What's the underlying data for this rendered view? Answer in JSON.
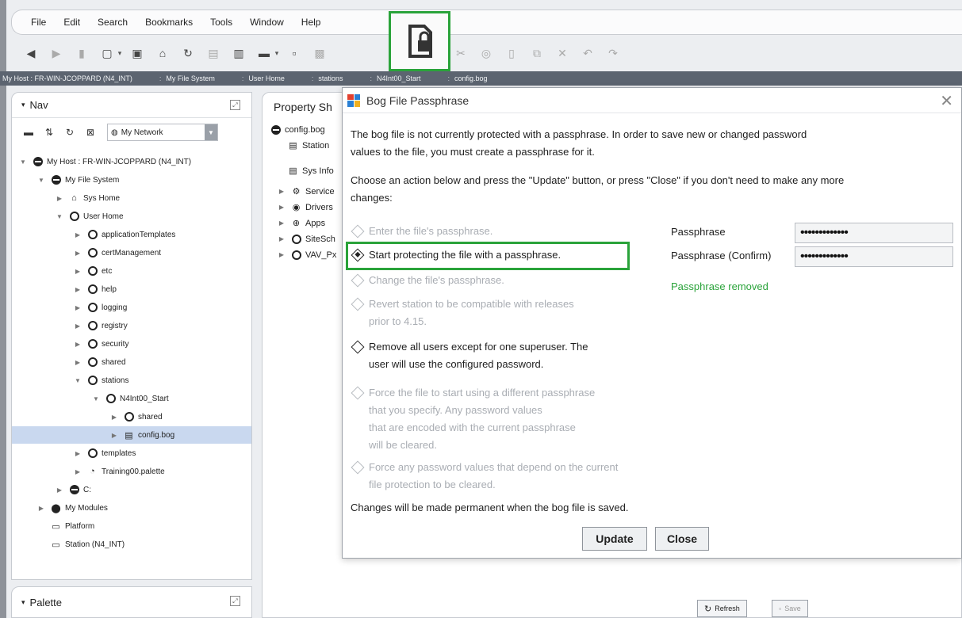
{
  "menubar": [
    "File",
    "Edit",
    "Search",
    "Bookmarks",
    "Tools",
    "Window",
    "Help"
  ],
  "breadcrumbs": [
    "My Host : FR-WIN-JCOPPARD (N4_INT)",
    "My File System",
    "User Home",
    "stations",
    "N4Int00_Start",
    "config.bog"
  ],
  "nav": {
    "title": "Nav",
    "network_select": "My Network",
    "tree": [
      {
        "label": "My Host : FR-WIN-JCOPPARD (N4_INT)",
        "depth": 0,
        "twisty": "open",
        "icon": "host-icon"
      },
      {
        "label": "My File System",
        "depth": 1,
        "twisty": "open",
        "icon": "disk-icon"
      },
      {
        "label": "Sys Home",
        "depth": 2,
        "twisty": "closed",
        "icon": "home-icon"
      },
      {
        "label": "User Home",
        "depth": 2,
        "twisty": "open",
        "icon": "folder-icon"
      },
      {
        "label": "applicationTemplates",
        "depth": 3,
        "twisty": "closed",
        "icon": "folder-icon"
      },
      {
        "label": "certManagement",
        "depth": 3,
        "twisty": "closed",
        "icon": "folder-icon"
      },
      {
        "label": "etc",
        "depth": 3,
        "twisty": "closed",
        "icon": "folder-icon"
      },
      {
        "label": "help",
        "depth": 3,
        "twisty": "closed",
        "icon": "folder-icon"
      },
      {
        "label": "logging",
        "depth": 3,
        "twisty": "closed",
        "icon": "folder-icon"
      },
      {
        "label": "registry",
        "depth": 3,
        "twisty": "closed",
        "icon": "folder-icon"
      },
      {
        "label": "security",
        "depth": 3,
        "twisty": "closed",
        "icon": "folder-icon"
      },
      {
        "label": "shared",
        "depth": 3,
        "twisty": "closed",
        "icon": "folder-icon"
      },
      {
        "label": "stations",
        "depth": 3,
        "twisty": "open",
        "icon": "folder-icon"
      },
      {
        "label": "N4Int00_Start",
        "depth": 4,
        "twisty": "open",
        "icon": "folder-icon"
      },
      {
        "label": "shared",
        "depth": 5,
        "twisty": "closed",
        "icon": "folder-icon"
      },
      {
        "label": "config.bog",
        "depth": 5,
        "twisty": "closed",
        "icon": "bog-file-icon",
        "selected": true
      },
      {
        "label": "templates",
        "depth": 3,
        "twisty": "closed",
        "icon": "folder-icon"
      },
      {
        "label": "Training00.palette",
        "depth": 3,
        "twisty": "closed",
        "icon": "palette-file-icon"
      },
      {
        "label": "C:",
        "depth": 2,
        "twisty": "closed",
        "icon": "disk-icon"
      },
      {
        "label": "My Modules",
        "depth": 1,
        "twisty": "closed",
        "icon": "modules-icon"
      },
      {
        "label": "Platform",
        "depth": 1,
        "twisty": "none",
        "icon": "platform-icon"
      },
      {
        "label": "Station (N4_INT)",
        "depth": 1,
        "twisty": "none",
        "icon": "station-icon"
      }
    ]
  },
  "palette": {
    "title": "Palette"
  },
  "property_sheet": {
    "tab": "Property Sh",
    "rows": [
      "config.bog",
      "Station",
      "Sys Info",
      "Service",
      "Drivers",
      "Apps",
      "SiteSch",
      "VAV_Px"
    ],
    "refresh_label": "Refresh",
    "save_label": "Save"
  },
  "dialog": {
    "title": "Bog File Passphrase",
    "intro_line1": "The bog file is not currently protected with a passphrase. In order to save new or changed password",
    "intro_line2": "values to the file, you must create a passphrase for it.",
    "instruction_line1": "Choose an action below and press the \"Update\" button, or press \"Close\" if you don't need to make any more",
    "instruction_line2": "changes:",
    "options": [
      {
        "lines": [
          "Enter the file's passphrase."
        ],
        "enabled": false,
        "selected": false
      },
      {
        "lines": [
          "Start protecting the file with a passphrase."
        ],
        "enabled": true,
        "selected": true
      },
      {
        "lines": [
          "Change the file's passphrase."
        ],
        "enabled": false,
        "selected": false
      },
      {
        "lines": [
          "Revert station to be compatible with releases",
          "prior to 4.15."
        ],
        "enabled": false,
        "selected": false
      },
      {
        "lines": [
          "Remove all users except for one superuser. The",
          "user will use the configured password."
        ],
        "enabled": true,
        "selected": false
      },
      {
        "lines": [
          "Force the file to start using a different passphrase",
          "that you specify. Any password values",
          "that are encoded with the current passphrase",
          "will be cleared."
        ],
        "enabled": false,
        "selected": false
      },
      {
        "lines": [
          "Force any password values that depend on the current",
          "file protection to be cleared."
        ],
        "enabled": false,
        "selected": false
      }
    ],
    "footer_note": "Changes will be made permanent when the bog file is saved.",
    "passphrase_label": "Passphrase",
    "passphrase_value": "•••••••••••••",
    "confirm_label": "Passphrase (Confirm)",
    "confirm_value": "•••••••••••••",
    "status": "Passphrase removed",
    "update_label": "Update",
    "close_label": "Close"
  },
  "colors": {
    "highlight": "#2aa33a",
    "status": "#2aa33a",
    "selection": "#c9d8ef"
  }
}
